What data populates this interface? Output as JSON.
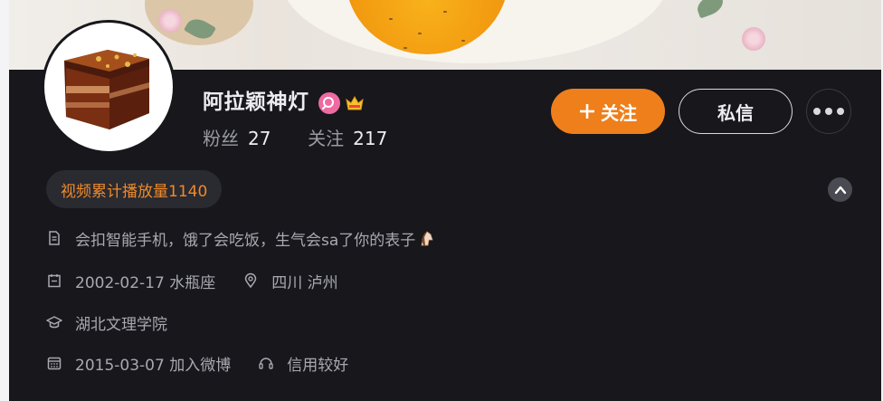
{
  "profile": {
    "name": "阿拉颖神灯",
    "badges": [
      "search-badge-icon",
      "crown-badge-icon"
    ],
    "stats": {
      "followers_label": "粉丝",
      "followers_count": "27",
      "following_label": "关注",
      "following_count": "217"
    }
  },
  "actions": {
    "follow_label": "关注",
    "message_label": "私信",
    "more_icon": "more-dots-icon"
  },
  "play_count_tag": "视频累计播放量1140",
  "details": {
    "bio": "会扣智能手机，饿了会吃饭，生气会sa了你的表子",
    "bio_emoji": "horse-emoji",
    "birthday": "2002-02-17 水瓶座",
    "location": "四川 泸州",
    "school": "湖北文理学院",
    "joined": "2015-03-07 加入微博",
    "credit": "信用较好"
  },
  "colors": {
    "background": "#17171c",
    "accent": "#ee7f1b",
    "tag_text": "#ee8a2a",
    "text_primary": "#ededf0",
    "text_secondary": "#a8a8b0"
  }
}
